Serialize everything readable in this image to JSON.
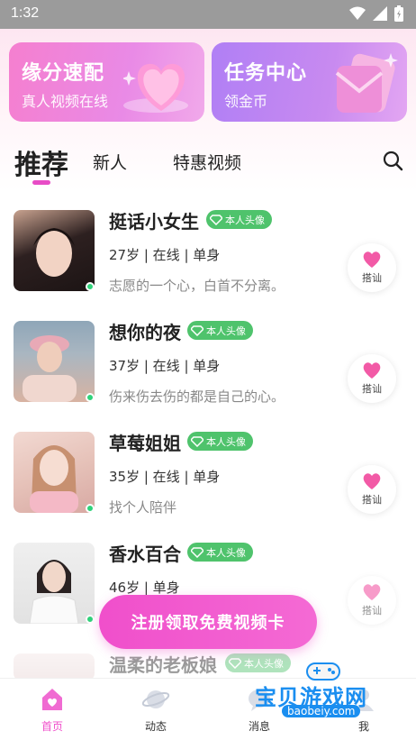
{
  "status": {
    "time": "1:32"
  },
  "promos": [
    {
      "title": "缘分速配",
      "subtitle": "真人视频在线"
    },
    {
      "title": "任务中心",
      "subtitle": "领金币"
    }
  ],
  "tabs": {
    "recommended": "推荐",
    "new": "新人",
    "video": "特惠视频"
  },
  "badge_label": "本人头像",
  "greet_label": "搭讪",
  "users": [
    {
      "name": "挺话小女生",
      "meta": "27岁 | 在线 | 单身",
      "bio": "志愿的一个心，白首不分离。"
    },
    {
      "name": "想你的夜",
      "meta": "37岁 | 在线 | 单身",
      "bio": "伤来伤去伤的都是自己的心。"
    },
    {
      "name": "草莓姐姐",
      "meta": "35岁 | 在线 | 单身",
      "bio": "找个人陪伴"
    },
    {
      "name": "香水百合",
      "meta": "46岁 | 单身",
      "bio": ""
    },
    {
      "name": "温柔的老板娘",
      "meta": "",
      "bio": ""
    }
  ],
  "cta": "注册领取免费视频卡",
  "nav": {
    "home": "首页",
    "moments": "动态",
    "messages": "消息",
    "me": "我"
  },
  "watermark": {
    "text": "宝贝游戏网",
    "url": "baobeiy.com"
  },
  "colors": {
    "accent": "#f04fcb",
    "verified": "#4fc36c",
    "online": "#2fd37a"
  }
}
